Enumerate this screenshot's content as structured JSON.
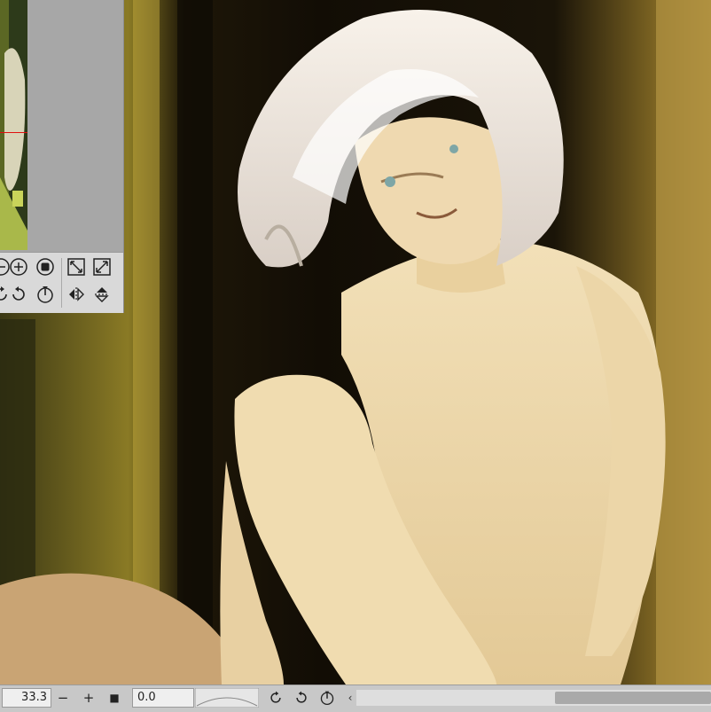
{
  "canvas": {
    "artwork": "painting-canvas"
  },
  "navigator": {
    "tools": [
      {
        "name": "zoom-out-icon"
      },
      {
        "name": "zoom-in-icon"
      },
      {
        "name": "actual-size-icon"
      },
      {
        "name": "fit-to-window-icon"
      },
      {
        "name": "fill-window-icon"
      },
      {
        "name": "rotate-left-icon"
      },
      {
        "name": "rotate-right-icon"
      },
      {
        "name": "reset-rotation-icon"
      },
      {
        "name": "flip-horizontal-icon"
      },
      {
        "name": "flip-vertical-icon"
      }
    ]
  },
  "status": {
    "zoom_value": "33.3",
    "zoom_out_label": "−",
    "zoom_in_label": "+",
    "fit_label": "■",
    "angle_value": "0.0",
    "scroll_left_label": "‹"
  },
  "colors": {
    "panel": "#d9d9d9",
    "statusbar": "#c8c8c8",
    "navigator_frame": "#e01010"
  }
}
